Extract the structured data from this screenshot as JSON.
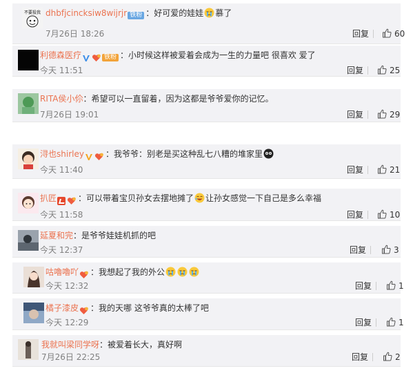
{
  "comments": [
    {
      "name": "dhbfjcincksiw8wijrjr",
      "badges": [
        "fans-blue"
      ],
      "fans_label": "铁粉",
      "text_before": "好可爱的娃娃",
      "emojis": [
        "cry"
      ],
      "text_after": "慕了",
      "time": "7月26日 18:26",
      "reply": "回复",
      "likes": "60",
      "avatar_caption": "不要投我"
    },
    {
      "name": "利德森医疗",
      "badges": [
        "v-blue",
        "heart",
        "fans-orange"
      ],
      "fans_label": "铁粉",
      "text_before": "小时候这样被爱着会成为一生的力量吧 很喜欢 爱了",
      "emojis": [],
      "text_after": "",
      "time": "今天 11:51",
      "reply": "回复",
      "likes": "25"
    },
    {
      "name": "RITA侯小伱",
      "badges": [],
      "fans_label": "",
      "text_before": "希望可以一直留着，因为这都是爷爷爱你的记忆。",
      "emojis": [],
      "text_after": "",
      "time": "7月26日 19:01",
      "reply": "回复",
      "likes": "29"
    },
    {
      "name": "浔也shirley",
      "badges": [
        "v-orange",
        "heart"
      ],
      "fans_label": "",
      "text_before": "我爷爷：别老是买这种乱七八糟的堆家里",
      "emojis": [
        "dark"
      ],
      "text_after": "",
      "time": "今天 11:40",
      "reply": "回复",
      "likes": "21"
    },
    {
      "name": "扒匠",
      "badges": [
        "red",
        "heart"
      ],
      "fans_label": "",
      "text_before": "可以带着宝贝孙女去摆地摊了",
      "emojis": [
        "laugh"
      ],
      "text_after": "让孙女感觉一下自己是多么幸福",
      "time": "今天 11:58",
      "reply": "回复",
      "likes": "10"
    },
    {
      "name": "延夏和完",
      "badges": [],
      "fans_label": "",
      "text_before": "是爷爷娃娃机抓的吧",
      "emojis": [],
      "text_after": "",
      "time": "今天 12:37",
      "reply": "回复",
      "likes": "3"
    },
    {
      "name": "咕嚕嚕吖",
      "badges": [
        "heart"
      ],
      "fans_label": "",
      "text_before": "我想起了我的外公",
      "emojis": [
        "cry",
        "cry",
        "cry"
      ],
      "text_after": "",
      "time": "今天 12:32",
      "reply": "回复",
      "likes": "1"
    },
    {
      "name": "橘子漆皮",
      "badges": [
        "heart"
      ],
      "fans_label": "",
      "text_before": "我的天哪 这爷爷真的太棒了吧",
      "emojis": [],
      "text_after": "",
      "time": "今天 12:29",
      "reply": "回复",
      "likes": "1"
    },
    {
      "name": "我就叫梁同学呀",
      "badges": [],
      "fans_label": "",
      "text_before": "被爱着长大，真好啊",
      "emojis": [],
      "text_after": "",
      "time": "7月26日 22:25",
      "reply": "回复",
      "likes": "2"
    }
  ],
  "colors": {
    "name": "#eb7350",
    "panel": "#f2f2f5",
    "muted": "#808080",
    "fans_blue": "#6aa7e2",
    "fans_orange": "#f2a33a",
    "v_blue": "#3e8fe8",
    "v_orange": "#f5a623"
  }
}
